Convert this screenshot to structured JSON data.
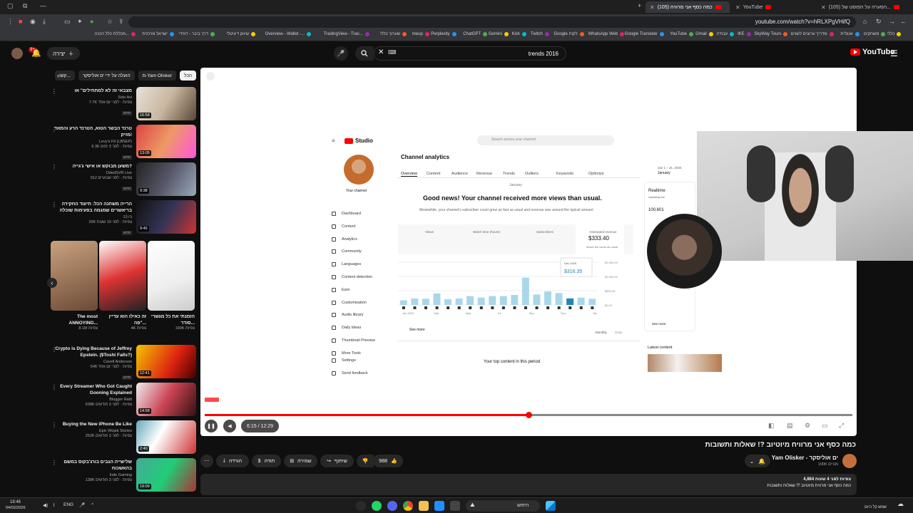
{
  "colors": {
    "accent": "#ff0000",
    "bg": "#0f0f0f",
    "surface": "#272727"
  },
  "browser": {
    "tabs": [
      {
        "label": "(105) כמה כסף אני מרוויח",
        "active": true
      },
      {
        "label": "YouTube",
        "active": false
      },
      {
        "label": "(105) הסערה על הפוסט של...",
        "active": false
      }
    ],
    "url": "youtube.com/watch?v=hRLXPgVHifQ",
    "bookmarks": [
      "כללי",
      "משחקים",
      "אנגלית",
      "מדריך ערוצים לשנים",
      "SkyWay Tours",
      "IKE",
      "עבודה",
      "Gmail",
      "YouTube",
      "Google Translate",
      "WhatsApp Web",
      "Google לקוח",
      "Twitch",
      "Kick",
      "Gemini",
      "ChatGPT",
      "Perplexity",
      "meup",
      "שערוך כללי",
      "TradingView - Trac...",
      "Overview - Wallet -...",
      "שיווק דיגיטלי",
      "דרך ביבר - דווידי",
      "ישראל מרכזית",
      "מכללת כלל הכנה..."
    ]
  },
  "masthead": {
    "search_query": "trends 2016",
    "create_label": "יצירה",
    "notif_count": "9+",
    "logo_text": "YouTube"
  },
  "sidebar": {
    "chips": [
      "הכל",
      "מ-Yam Olisker",
      "הועלה על ידי ים אוליסקר",
      "קשו..."
    ],
    "recs": [
      {
        "title": "מצבאי זה לא למתחילים\" או",
        "channel": "Solo Avi",
        "views": "7.7K צפיות · לפני יום אחד",
        "badge": "חדש",
        "duration": "16:58"
      },
      {
        "title": "טרנד הבשר הטוא, הטרנד הרע והמאד מזיק!",
        "channel": "Levy's Fit (LBSEP)",
        "views": "9.3K צפיות · לפני 3 ימים",
        "badge": "חדש",
        "duration": "13:05"
      },
      {
        "title": "משען מבוקש או אישי ג'גייה?",
        "channel": "OdedSVR Live",
        "views": "912 צפיות · לפני שבועיים",
        "badge": "חדש",
        "duration": "9:38"
      },
      {
        "title": "הרייה משחנה הכל: תיעוד החקירה בריאשרים שמגמה בפעימות שוכלה",
        "channel": "ג'ו 13",
        "views": "26K צפיות · לפני 19 שעות",
        "badge": "חדש",
        "duration": "9:45"
      }
    ],
    "shorts": [
      {
        "title": "The most ANNOYING...",
        "views": "8.1M צפיות"
      },
      {
        "title": "זה כאילו הוא עדיין פה\"...",
        "views": "4K צפיות"
      },
      {
        "title": "הזמנתי את כל מגשרי סודר...",
        "views": "190K צפיות"
      }
    ],
    "recs2": [
      {
        "title": "Crypto is Dying Because of Jeffrey Epstein. ($Toshi Falls?)",
        "channel": "Cavell Anderson",
        "views": "546 צפיות · לפני יום אחד",
        "badge": "חדש",
        "duration": "12:41"
      },
      {
        "title": "Every Streamer Who Got Caught Gooning Explained",
        "channel": "Blogger Ratti",
        "views": "638K צפיות · לפני 3 חודשים",
        "badge": "",
        "duration": "14:58"
      },
      {
        "title": "Buying the New iPhone Be Like",
        "channel": "Epic Wojak Stories",
        "views": "252K צפיות · לפני 3 חודשים",
        "badge": "",
        "duration": "2:40"
      },
      {
        "title": "שלישייה הגבים בורג'בקוס במשם בהאשכוח",
        "channel": "Inde Gaming",
        "views": "138K צפיות · לפני 3 חודשים",
        "badge": "",
        "duration": "19:09"
      }
    ]
  },
  "player": {
    "time": "6:15 / 12:29",
    "progress": 0.5
  },
  "studio": {
    "brand": "Studio",
    "search_placeholder": "Search across your channel",
    "your_channel": "Your channel",
    "page_title": "Channel analytics",
    "tabs": [
      "Overview",
      "Content",
      "Audience",
      "Revenue",
      "Trends",
      "Outliers",
      "Keywords",
      "Optimize"
    ],
    "sidebar": [
      "Dashboard",
      "Content",
      "Analytics",
      "Community",
      "Languages",
      "Content detection",
      "Earn",
      "Customization",
      "Audio library",
      "Daily Ideas",
      "Thumbnail Preview",
      "More Tools"
    ],
    "settings": "Settings",
    "feedback": "Send feedback",
    "month_label": "January",
    "headline": "Good news! Your channel received more views than usual.",
    "subline": "Meanwhile, your channel's subscriber count grew as fast as usual and revenue was around the typical amount",
    "metrics": [
      "Views",
      "Watch time (hours)",
      "Subscribers",
      "Estimated revenue"
    ],
    "revenue_value": "$333.40",
    "revenue_note": "About the same as usual",
    "tooltip_date": "Dec 2025",
    "tooltip_value": "$316.35",
    "see_more": "See more",
    "toggle_monthly": "Monthly",
    "toggle_daily": "Daily",
    "top_content": "Your top content in this period",
    "date_range": "Jan 1 – 31, 2026",
    "date_month": "January",
    "realtime": "Realtime",
    "realtime_sub": "Updating live",
    "realtime_value": "100,601",
    "latest_content": "Latest content",
    "yaxis": [
      "$1,500.00",
      "$1,000.00",
      "$500.00",
      "$0.00"
    ],
    "xaxis": [
      "Jan 2024",
      "Mar",
      "May",
      "Jul",
      "Sep",
      "Nov",
      "Jan"
    ]
  },
  "chart_data": {
    "type": "bar",
    "title": "",
    "ylabel": "",
    "ylim": [
      0,
      1500
    ],
    "values": [
      120,
      170,
      160,
      300,
      150,
      170,
      230,
      190,
      230,
      230,
      260,
      710,
      270,
      350,
      310,
      170,
      190,
      160
    ]
  },
  "video": {
    "title": "כמה כסף אני מרוויח מיוטיוב ?! שאלות ותשובות",
    "channel": "Yam Olisker - ים אוליסקר",
    "subs": "100K מנויים",
    "likes": "988",
    "share": "שיתוף",
    "save": "שמירה",
    "thanks": "תודה",
    "download": "הורדה",
    "desc_line1": "4,884 צפיות לפני 4 שעות",
    "desc_line2": "כמה כסף אני מרוויח מיוטיוב ?! שאלות ותשובות"
  },
  "taskbar": {
    "search": "חיפוש",
    "time": "18:46",
    "date": "04/02/2026",
    "lang": "ENG",
    "weather": "שמש קל היום"
  }
}
